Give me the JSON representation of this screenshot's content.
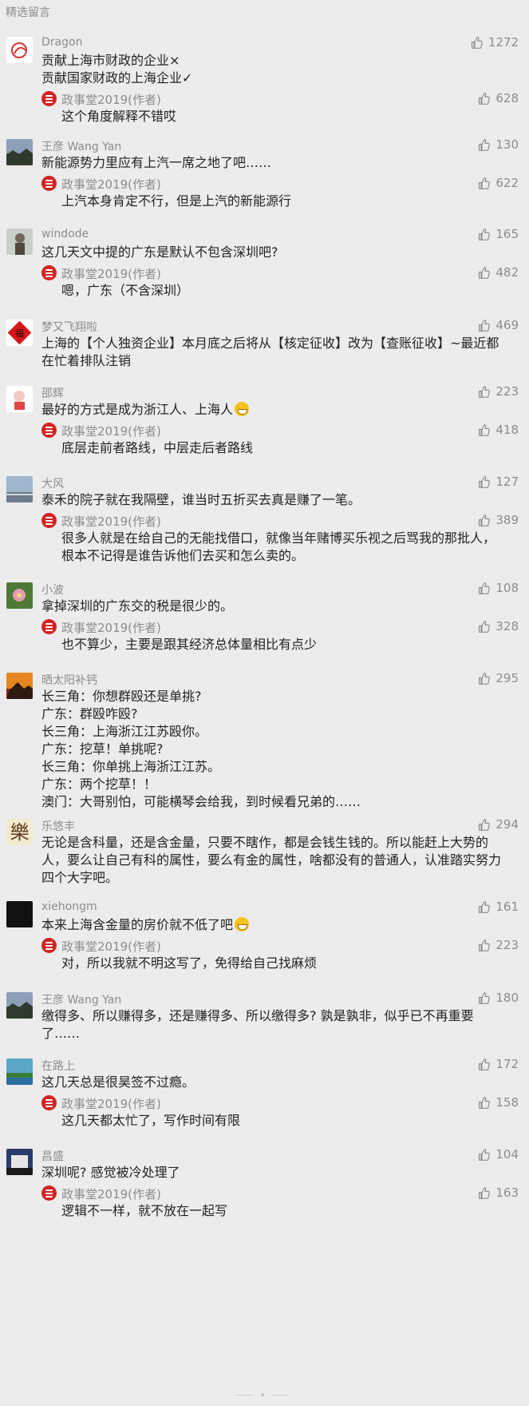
{
  "section_title": "精选留言",
  "reply_author": "政事堂2019(作者)",
  "comments": [
    {
      "nick": "Dragon",
      "likes": "1272",
      "lines": [
        "贡献上海市财政的企业×",
        "贡献国家财政的上海企业✓"
      ],
      "reply": {
        "likes": "628",
        "lines": [
          "这个角度解释不错哎"
        ]
      }
    },
    {
      "nick": "王彦 Wang Yan",
      "likes": "130",
      "lines": [
        "新能源势力里应有上汽一席之地了吧……"
      ],
      "reply": {
        "likes": "622",
        "lines": [
          "上汽本身肯定不行，但是上汽的新能源行"
        ]
      }
    },
    {
      "nick": "windode",
      "likes": "165",
      "lines": [
        "这几天文中提的广东是默认不包含深圳吧?"
      ],
      "reply": {
        "likes": "482",
        "lines": [
          "嗯，广东（不含深圳）"
        ]
      }
    },
    {
      "nick": "梦又飞翔啦",
      "likes": "469",
      "lines": [
        "上海的【个人独资企业】本月底之后将从【核定征收】改为【查账征收】~最近都",
        "在忙着排队注销"
      ]
    },
    {
      "nick": "邵辉",
      "likes": "223",
      "lines": [
        "最好的方式是成为浙江人、上海人"
      ],
      "emoji": true,
      "reply": {
        "likes": "418",
        "lines": [
          "底层走前者路线，中层走后者路线"
        ]
      }
    },
    {
      "nick": "大风",
      "likes": "127",
      "lines": [
        "泰禾的院子就在我隔壁，谁当时五折买去真是赚了一笔。"
      ],
      "reply": {
        "likes": "389",
        "lines": [
          "很多人就是在给自己的无能找借口，就像当年赌博买乐视之后骂我的那批人，",
          "根本不记得是谁告诉他们去买和怎么卖的。"
        ]
      }
    },
    {
      "nick": "小波",
      "likes": "108",
      "lines": [
        "拿掉深圳的广东交的税是很少的。"
      ],
      "reply": {
        "likes": "328",
        "lines": [
          "也不算少，主要是跟其经济总体量相比有点少"
        ]
      }
    },
    {
      "nick": "晒太阳补钙",
      "likes": "295",
      "lines": [
        "长三角：你想群殴还是单挑?",
        "广东：群殴咋殴?",
        "长三角：上海浙江江苏殴你。",
        "广东：挖草！单挑呢?",
        "长三角：你单挑上海浙江江苏。",
        "广东：两个挖草！！",
        "澳门：大哥别怕，可能横琴会给我，到时候看兄弟的……"
      ]
    },
    {
      "nick": "乐悠丰",
      "likes": "294",
      "lines": [
        "无论是含科量，还是含金量，只要不瞎作，都是会钱生钱的。所以能赶上大势的",
        "人，要么让自己有科的属性，要么有金的属性，啥都没有的普通人，认准踏实努力",
        "四个大字吧。"
      ]
    },
    {
      "nick": "xiehongm",
      "likes": "161",
      "lines": [
        "本来上海含金量的房价就不低了吧"
      ],
      "emoji": true,
      "reply": {
        "likes": "223",
        "lines": [
          "对，所以我就不明这写了，免得给自己找麻烦"
        ]
      }
    },
    {
      "nick": "王彦 Wang Yan",
      "likes": "180",
      "lines": [
        "缴得多、所以赚得多，还是赚得多、所以缴得多? 孰是孰非，似乎已不再重要",
        "了……"
      ]
    },
    {
      "nick": "在路上",
      "likes": "172",
      "lines": [
        "这几天总是很昊签不过瘾。"
      ],
      "reply": {
        "likes": "158",
        "lines": [
          "这几天都太忙了，写作时间有限"
        ]
      }
    },
    {
      "nick": "昌盛",
      "likes": "104",
      "lines": [
        "深圳呢? 感觉被冷处理了"
      ],
      "reply": {
        "likes": "163",
        "lines": [
          "逻辑不一样，就不放在一起写"
        ]
      }
    }
  ]
}
